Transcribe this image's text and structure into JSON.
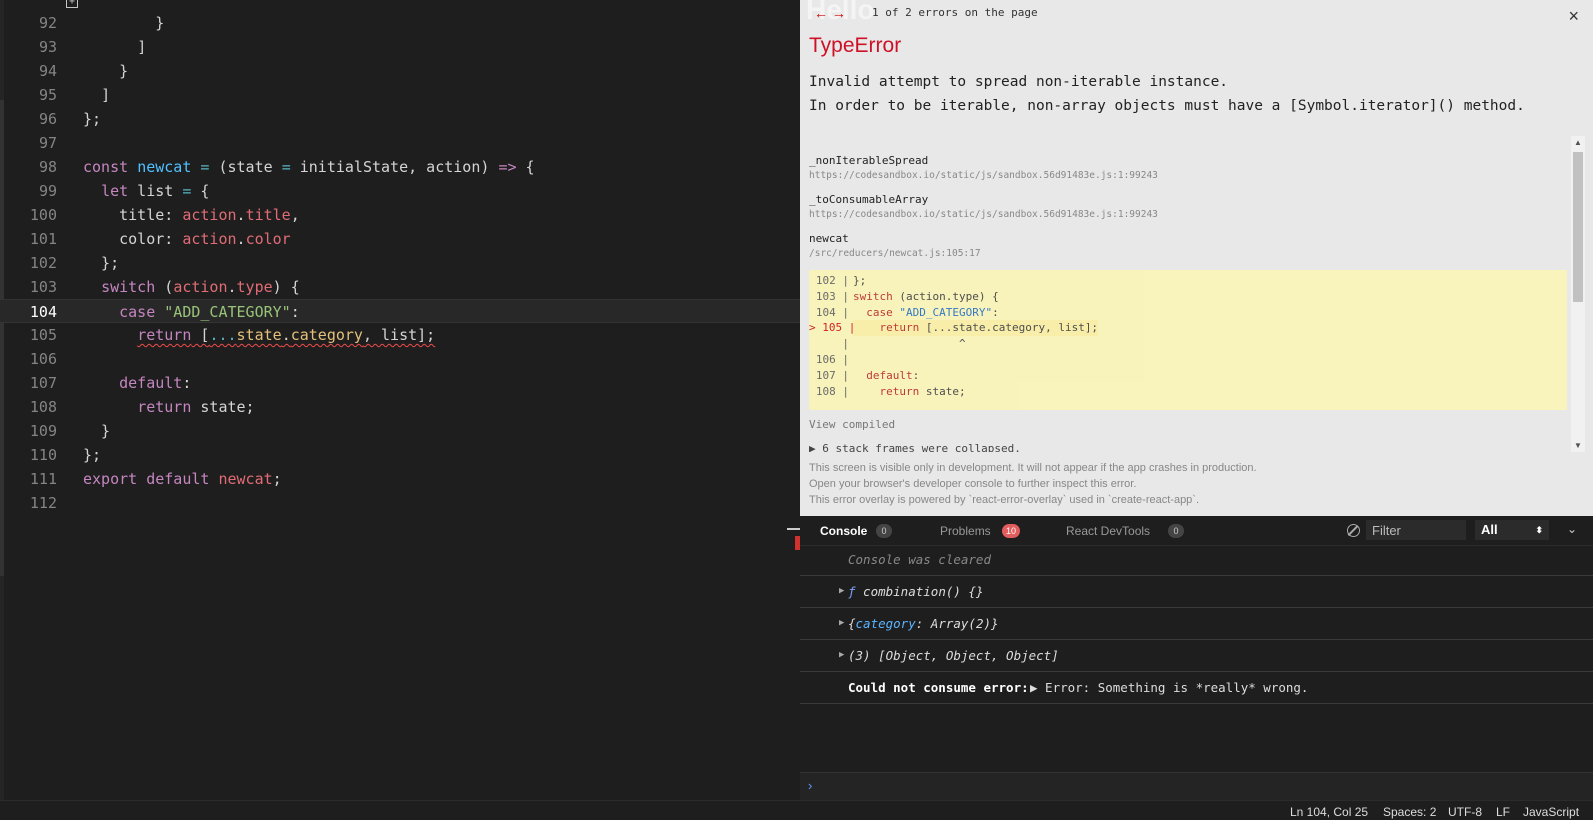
{
  "editor": {
    "fold_glyph": "+",
    "lines": [
      {
        "n": "92",
        "html": "        <span class='pl'>}</span>"
      },
      {
        "n": "93",
        "html": "      <span class='pl'>]</span>"
      },
      {
        "n": "94",
        "html": "    <span class='pl'>}</span>"
      },
      {
        "n": "95",
        "html": "  <span class='pl'>]</span>"
      },
      {
        "n": "96",
        "html": "<span class='pl'>};</span>"
      },
      {
        "n": "97",
        "html": ""
      },
      {
        "n": "98",
        "html": "<span class='kw'>const</span> <span class='fn'>newcat</span> <span class='op'>=</span> (state <span class='op'>=</span> initialState, action) <span class='kw'>=&gt;</span> {"
      },
      {
        "n": "99",
        "html": "  <span class='kw'>let</span> list <span class='op'>=</span> {"
      },
      {
        "n": "100",
        "html": "    <span class='prop'>title</span>: <span class='val'>action</span>.<span class='val'>title</span>,"
      },
      {
        "n": "101",
        "html": "    <span class='prop'>color</span>: <span class='val'>action</span>.<span class='val'>color</span>"
      },
      {
        "n": "102",
        "html": "  };"
      },
      {
        "n": "103",
        "html": "  <span class='kw'>switch</span> (<span class='val'>action</span>.<span class='val'>type</span>) {"
      },
      {
        "n": "104",
        "html": "    <span class='kw'>case</span> <span class='str'>\"ADD_CATEGORY\"</span>:",
        "current": true
      },
      {
        "n": "105",
        "html": "      <span class='squiggle'><span class='kw'>return</span> [<span class='op'>...</span><span class='hl'>state</span>.<span class='hl'>category</span>, list];</span>"
      },
      {
        "n": "106",
        "html": ""
      },
      {
        "n": "107",
        "html": "    <span class='kw'>default</span>:"
      },
      {
        "n": "108",
        "html": "      <span class='kw'>return</span> state;"
      },
      {
        "n": "109",
        "html": "  }"
      },
      {
        "n": "110",
        "html": "};"
      },
      {
        "n": "111",
        "html": "<span class='kw'>export</span> <span class='kw'>default</span> <span class='val'>newcat</span>;"
      },
      {
        "n": "112",
        "html": ""
      }
    ]
  },
  "overlay": {
    "nav_arrows": "← →",
    "background_text": "Hello",
    "error_count": "1 of 2 errors on the page",
    "close_glyph": "×",
    "title": "TypeError",
    "message_line1": "Invalid attempt to spread non-iterable instance.",
    "message_line2": "In order to be iterable, non-array objects must have a [Symbol.iterator]() method.",
    "frames": [
      {
        "fn": "_nonIterableSpread",
        "loc": "https://codesandbox.io/static/js/sandbox.56d91483e.js:1:99243"
      },
      {
        "fn": "_toConsumableArray",
        "loc": "https://codesandbox.io/static/js/sandbox.56d91483e.js:1:99243"
      },
      {
        "fn": "newcat",
        "loc": "/src/reducers/newcat.js:105:17"
      }
    ],
    "snippet": [
      {
        "gut": "102 |",
        "html": "};"
      },
      {
        "gut": "103 |",
        "html": "<span class='s-kw'>switch</span> (action.type) {"
      },
      {
        "gut": "104 |",
        "html": "  <span class='s-kw'>case</span> <span class='s-str'>\"ADD_CATEGORY\"</span>:"
      },
      {
        "gut": "> 105 |",
        "html": "    <span class='s-kw'>return</span> [...state.category, list];",
        "hot": true
      },
      {
        "gut": "|",
        "html": "                ^"
      },
      {
        "gut": "106 |",
        "html": ""
      },
      {
        "gut": "107 |",
        "html": "  <span class='s-kw'>default</span>:"
      },
      {
        "gut": "108 |",
        "html": "    <span class='s-kw'>return</span> state;"
      }
    ],
    "view_compiled": "View compiled",
    "collapsed_frames": "▶ 6 stack frames were collapsed.",
    "footer": [
      "This screen is visible only in development. It will not appear if the app crashes in production.",
      "Open your browser's developer console to further inspect this error.",
      "This error overlay is powered by `react-error-overlay` used in `create-react-app`."
    ]
  },
  "devtools": {
    "tabs": [
      {
        "label": "Console",
        "count": "0"
      },
      {
        "label": "Problems",
        "count": "10"
      },
      {
        "label": "React DevTools",
        "count": "0"
      }
    ],
    "filter_placeholder": "Filter",
    "level": "All",
    "level_arrow": "⬍",
    "collapse_glyph": "⌄",
    "prompt_glyph": "›",
    "cleared": "Console was cleared",
    "rows": [
      {
        "html": "<span class='f-sym'>ƒ</span> combination() {}"
      },
      {
        "html": "{<span class='k-cat'>category</span>: Array(2)}"
      },
      {
        "html": "(3) [Object, Object, Object]"
      }
    ],
    "error_label": "Could not consume error:",
    "error_value": "▶ Error: Something is *really* wrong."
  },
  "statusbar": {
    "position": "Ln 104, Col 25",
    "spaces": "Spaces: 2",
    "encoding": "UTF-8",
    "eol": "LF",
    "language": "JavaScript"
  }
}
